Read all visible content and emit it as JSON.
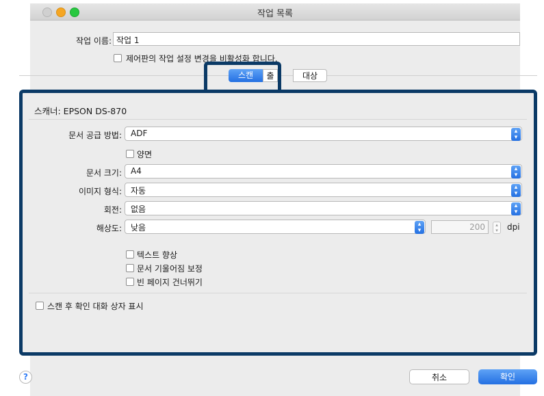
{
  "window": {
    "title": "작업 목록"
  },
  "job_name": {
    "label": "작업 이름:",
    "value": "작업 1"
  },
  "control_panel_checkbox": {
    "label": "제어판의 작업 설정 변경을 비활성화 합니다."
  },
  "tabs": [
    {
      "label": "스캔",
      "selected": true
    },
    {
      "label": "출력",
      "selected": false
    },
    {
      "label": "대상",
      "selected": false
    }
  ],
  "scanner": {
    "label": "스캐너: EPSON DS-870"
  },
  "source": {
    "label": "문서 공급 방법:",
    "value": "ADF"
  },
  "duplex": {
    "label": "양면"
  },
  "doc_size": {
    "label": "문서 크기:",
    "value": "A4"
  },
  "image_type": {
    "label": "이미지 형식:",
    "value": "자동"
  },
  "rotate": {
    "label": "회전:",
    "value": "없음"
  },
  "resolution": {
    "label": "해상도:",
    "value": "낮음",
    "dpi_value": "200",
    "unit": "dpi"
  },
  "options": [
    {
      "label": "텍스트 향상"
    },
    {
      "label": "문서 기울어짐 보정"
    },
    {
      "label": "빈 페이지 건너뛰기"
    }
  ],
  "confirm_checkbox": {
    "label": "스캔 후 확인 대화 상자 표시"
  },
  "help": {
    "icon": "?"
  },
  "buttons": {
    "cancel": "취소",
    "ok": "확인"
  },
  "colors": {
    "accent": "#2f7cf6",
    "highlight_border": "#0b3a66"
  }
}
